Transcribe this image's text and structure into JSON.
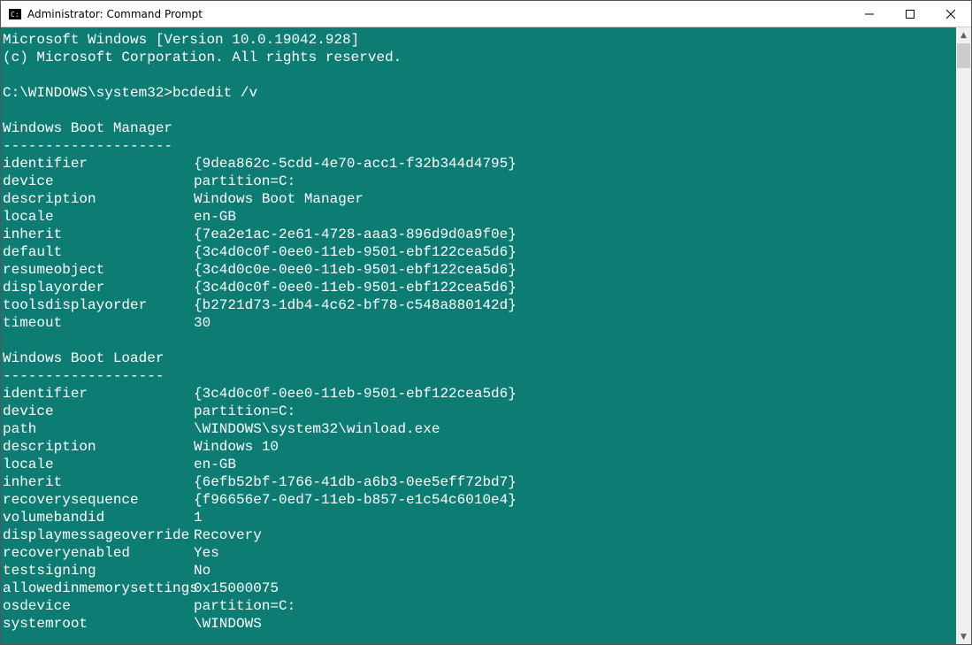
{
  "window": {
    "title": "Administrator: Command Prompt"
  },
  "header": {
    "line1": "Microsoft Windows [Version 10.0.19042.928]",
    "line2": "(c) Microsoft Corporation. All rights reserved."
  },
  "prompt": {
    "path": "C:\\WINDOWS\\system32>",
    "command": "bcdedit /v"
  },
  "sections": [
    {
      "title": "Windows Boot Manager",
      "divider": "--------------------",
      "entries": [
        {
          "key": "identifier",
          "value": "{9dea862c-5cdd-4e70-acc1-f32b344d4795}"
        },
        {
          "key": "device",
          "value": "partition=C:"
        },
        {
          "key": "description",
          "value": "Windows Boot Manager"
        },
        {
          "key": "locale",
          "value": "en-GB"
        },
        {
          "key": "inherit",
          "value": "{7ea2e1ac-2e61-4728-aaa3-896d9d0a9f0e}"
        },
        {
          "key": "default",
          "value": "{3c4d0c0f-0ee0-11eb-9501-ebf122cea5d6}"
        },
        {
          "key": "resumeobject",
          "value": "{3c4d0c0e-0ee0-11eb-9501-ebf122cea5d6}"
        },
        {
          "key": "displayorder",
          "value": "{3c4d0c0f-0ee0-11eb-9501-ebf122cea5d6}"
        },
        {
          "key": "toolsdisplayorder",
          "value": "{b2721d73-1db4-4c62-bf78-c548a880142d}"
        },
        {
          "key": "timeout",
          "value": "30"
        }
      ]
    },
    {
      "title": "Windows Boot Loader",
      "divider": "-------------------",
      "entries": [
        {
          "key": "identifier",
          "value": "{3c4d0c0f-0ee0-11eb-9501-ebf122cea5d6}"
        },
        {
          "key": "device",
          "value": "partition=C:"
        },
        {
          "key": "path",
          "value": "\\WINDOWS\\system32\\winload.exe"
        },
        {
          "key": "description",
          "value": "Windows 10"
        },
        {
          "key": "locale",
          "value": "en-GB"
        },
        {
          "key": "inherit",
          "value": "{6efb52bf-1766-41db-a6b3-0ee5eff72bd7}"
        },
        {
          "key": "recoverysequence",
          "value": "{f96656e7-0ed7-11eb-b857-e1c54c6010e4}"
        },
        {
          "key": "volumebandid",
          "value": "1"
        },
        {
          "key": "displaymessageoverride",
          "value": "Recovery"
        },
        {
          "key": "recoveryenabled",
          "value": "Yes"
        },
        {
          "key": "testsigning",
          "value": "No"
        },
        {
          "key": "allowedinmemorysettings",
          "value": "0x15000075"
        },
        {
          "key": "osdevice",
          "value": "partition=C:"
        },
        {
          "key": "systemroot",
          "value": "\\WINDOWS"
        }
      ]
    }
  ]
}
